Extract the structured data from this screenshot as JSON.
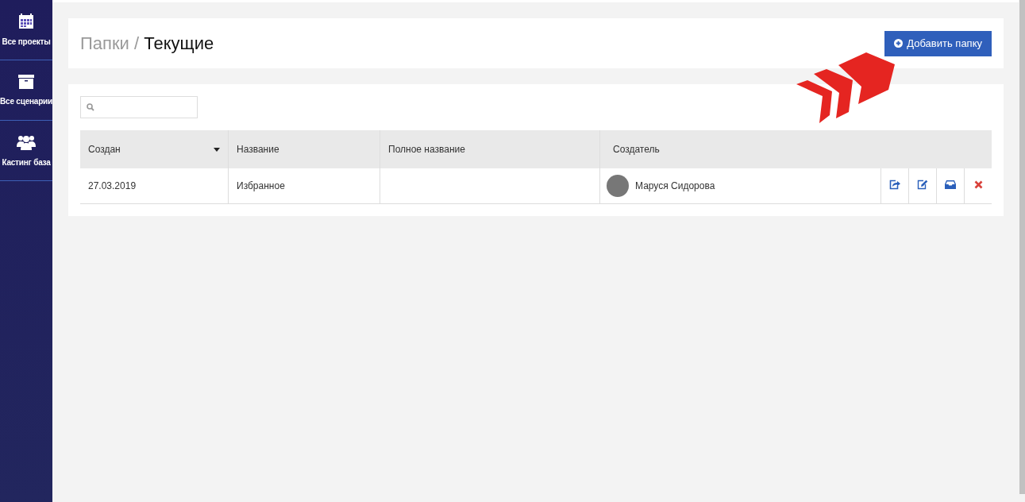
{
  "sidebar": {
    "items": [
      {
        "label": "Все проекты"
      },
      {
        "label": "Все сценарии"
      },
      {
        "label": "Кастинг база"
      }
    ]
  },
  "header": {
    "breadcrumb_parent": "Папки",
    "separator": "/",
    "title": "Текущие",
    "add_button": "Добавить папку"
  },
  "table": {
    "columns": [
      {
        "label": "Создан",
        "sorted": true
      },
      {
        "label": "Название",
        "sorted": false
      },
      {
        "label": "Полное название",
        "sorted": false
      },
      {
        "label": "Создатель",
        "sorted": false
      }
    ],
    "rows": [
      {
        "created": "27.03.2019",
        "name": "Избранное",
        "full_name": "",
        "creator": "Маруся Сидорова"
      }
    ]
  }
}
